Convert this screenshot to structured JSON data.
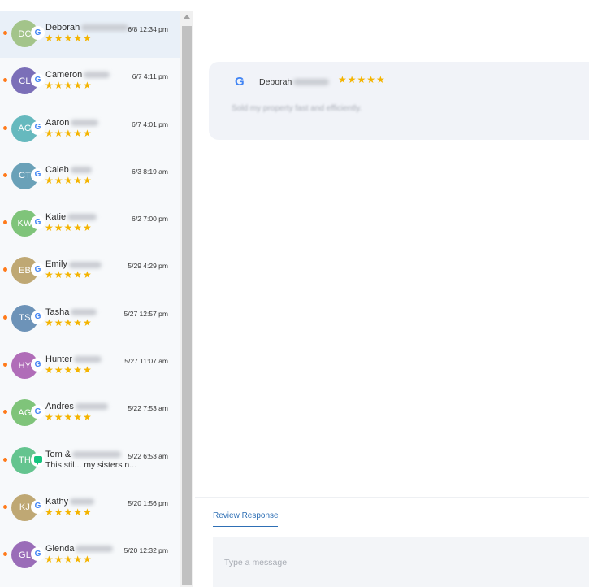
{
  "conversations": [
    {
      "initials": "DC",
      "color": "#a3c48a",
      "source": "google",
      "name": "Deborah",
      "time": "6/8 12:34 pm",
      "rating": "★★★★★",
      "selected": true
    },
    {
      "initials": "CL",
      "color": "#7b6fb8",
      "source": "google",
      "name": "Cameron",
      "time": "6/7 4:11 pm",
      "rating": "★★★★★"
    },
    {
      "initials": "AG",
      "color": "#66b9be",
      "source": "google",
      "name": "Aaron",
      "time": "6/7 4:01 pm",
      "rating": "★★★★★"
    },
    {
      "initials": "CT",
      "color": "#6aa1b8",
      "source": "google",
      "name": "Caleb",
      "time": "6/3 8:19 am",
      "rating": "★★★★★"
    },
    {
      "initials": "KW",
      "color": "#7fc47a",
      "source": "google",
      "name": "Katie",
      "time": "6/2 7:00 pm",
      "rating": "★★★★★"
    },
    {
      "initials": "EB",
      "color": "#bfa874",
      "source": "google",
      "name": "Emily",
      "time": "5/29 4:29 pm",
      "rating": "★★★★★"
    },
    {
      "initials": "TS",
      "color": "#6d93b8",
      "source": "google",
      "name": "Tasha",
      "time": "5/27 12:57 pm",
      "rating": "★★★★★"
    },
    {
      "initials": "HY",
      "color": "#b06db8",
      "source": "google",
      "name": "Hunter",
      "time": "5/27 11:07 am",
      "rating": "★★★★★"
    },
    {
      "initials": "AG",
      "color": "#7fc47a",
      "source": "google",
      "name": "Andres",
      "time": "5/22 7:53 am",
      "rating": "★★★★★"
    },
    {
      "initials": "TH",
      "color": "#64c48f",
      "source": "chat",
      "name": "Tom &",
      "time": "5/22 6:53 am",
      "preview": "This stil... my sisters n..."
    },
    {
      "initials": "KJ",
      "color": "#bfa874",
      "source": "google",
      "name": "Kathy",
      "time": "5/20 1:56 pm",
      "rating": "★★★★★"
    },
    {
      "initials": "GL",
      "color": "#9a6db8",
      "source": "google",
      "name": "Glenda",
      "time": "5/20 12:32 pm",
      "rating": "★★★★★"
    }
  ],
  "review": {
    "reviewer": "Deborah",
    "rating": "★★★★★",
    "text": "Sold my property fast and efficiently."
  },
  "response": {
    "tab_label": "Review Response",
    "placeholder": "Type a message"
  }
}
